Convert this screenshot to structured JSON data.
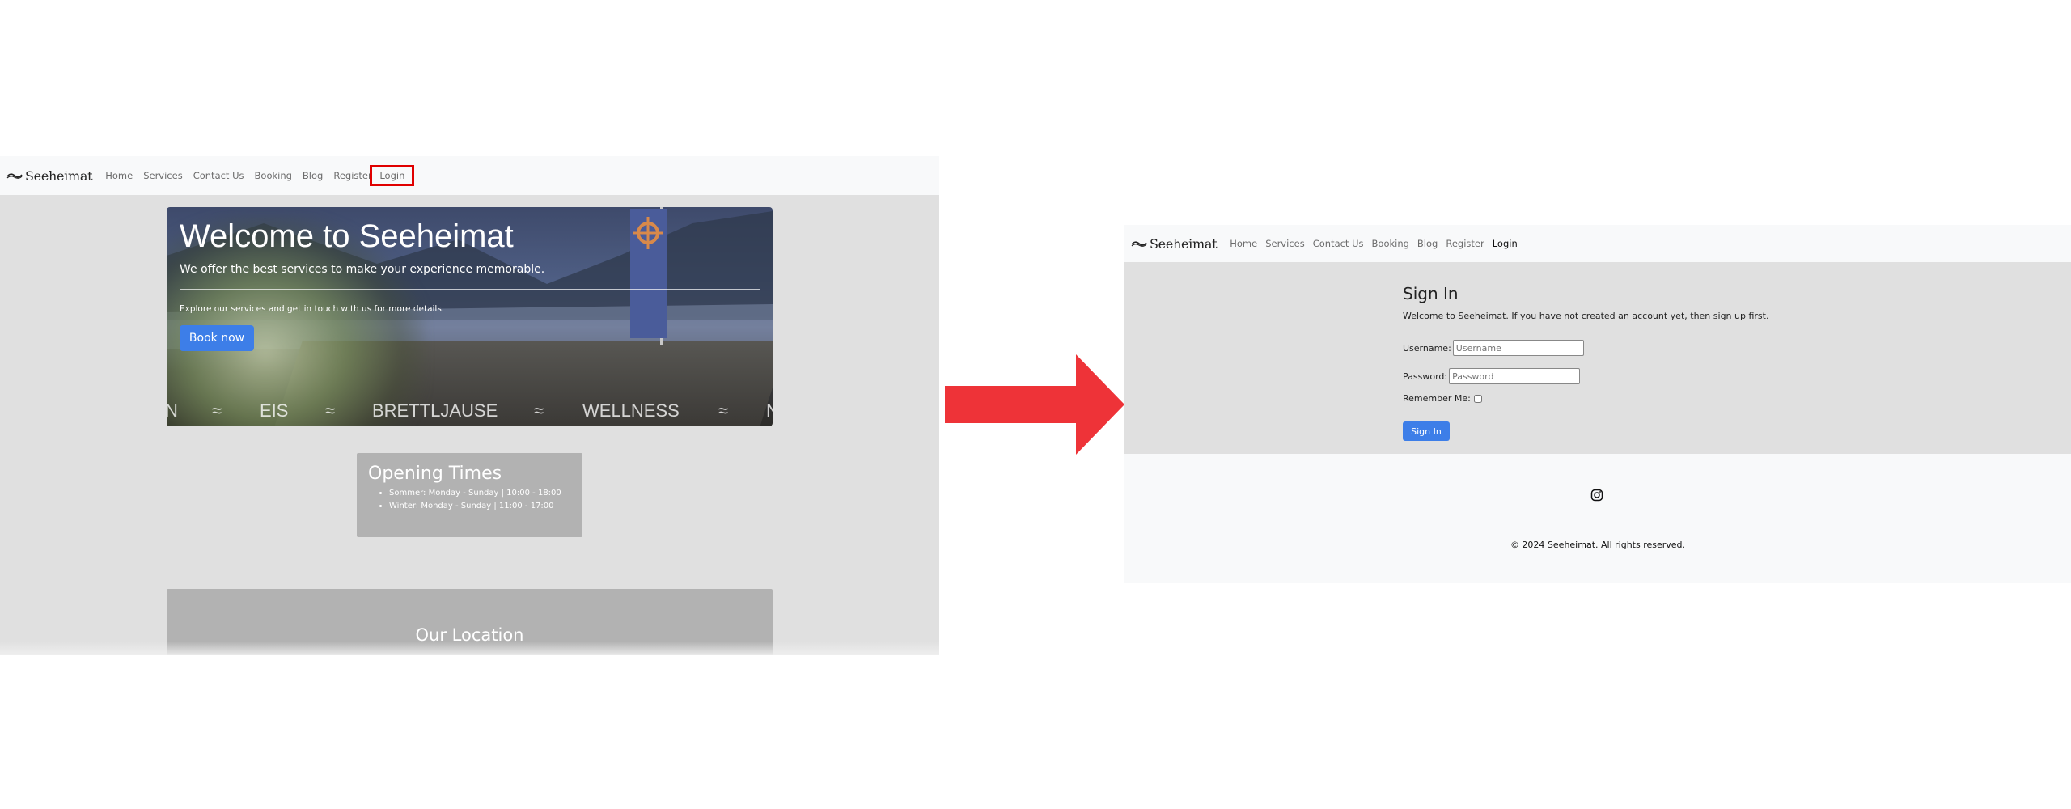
{
  "brand": {
    "name": "Seeheimat"
  },
  "left": {
    "nav": [
      {
        "label": "Home"
      },
      {
        "label": "Services"
      },
      {
        "label": "Contact Us"
      },
      {
        "label": "Booking"
      },
      {
        "label": "Blog"
      },
      {
        "label": "Register"
      },
      {
        "label": "Login"
      }
    ],
    "hero": {
      "title": "Welcome to Seeheimat",
      "lead": "We offer the best services to make your experience memorable.",
      "explore": "Explore our services and get in touch with us for more details.",
      "book_label": "Book now",
      "ticker": [
        "N",
        "≈",
        "EIS",
        "≈",
        "BRETTLJAUSE",
        "≈",
        "WELLNESS",
        "≈",
        "N"
      ]
    },
    "opening": {
      "title": "Opening Times",
      "items": [
        "Sommer: Monday - Sunday | 10:00 - 18:00",
        "Winter: Monday - Sunday | 11:00 - 17:00"
      ]
    },
    "location": {
      "title": "Our Location"
    }
  },
  "right": {
    "nav": [
      {
        "label": "Home"
      },
      {
        "label": "Services"
      },
      {
        "label": "Contact Us"
      },
      {
        "label": "Booking"
      },
      {
        "label": "Blog"
      },
      {
        "label": "Register"
      },
      {
        "label": "Login"
      }
    ],
    "signin": {
      "title": "Sign In",
      "welcome": "Welcome to Seeheimat. If you have not created an account yet, then sign up first.",
      "username_label": "Username:",
      "username_placeholder": "Username",
      "password_label": "Password:",
      "password_placeholder": "Password",
      "remember_label": "Remember Me:",
      "remember_checked": false,
      "submit_label": "Sign In"
    },
    "footer": {
      "icon": "instagram-icon",
      "copyright": "© 2024 Seeheimat. All rights reserved."
    }
  },
  "colors": {
    "primary": "#3d7ee8",
    "highlight": "#e00000",
    "arrow": "#ee3338",
    "panel_bg": "#e0e0e0",
    "navbar_bg": "#f8f9fa"
  }
}
